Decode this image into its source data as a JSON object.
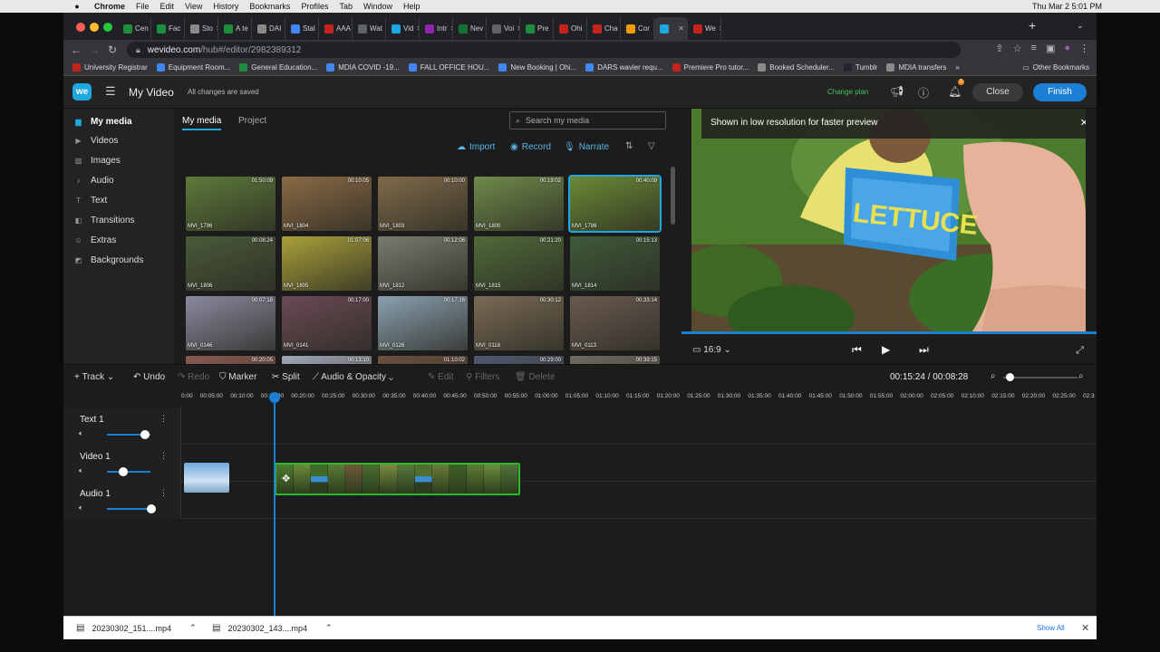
{
  "menubar": {
    "app": "Chrome",
    "items": [
      "File",
      "Edit",
      "View",
      "History",
      "Bookmarks",
      "Profiles",
      "Tab",
      "Window",
      "Help"
    ],
    "clock": "Thu Mar 2  5:01 PM"
  },
  "tabs": [
    {
      "label": "Cen",
      "color": "#1e8e3e"
    },
    {
      "label": "Fac",
      "color": "#1e8e3e"
    },
    {
      "label": "Sto",
      "color": "#8a8a8a"
    },
    {
      "label": "A te",
      "color": "#1e8e3e"
    },
    {
      "label": "DAI",
      "color": "#8a8a8a"
    },
    {
      "label": "Stal",
      "color": "#4285f4"
    },
    {
      "label": "AAA",
      "color": "#c5221f"
    },
    {
      "label": "Wat",
      "color": "#5f6368"
    },
    {
      "label": "Vid",
      "color": "#1ea7e1"
    },
    {
      "label": "Intr",
      "color": "#8e24aa"
    },
    {
      "label": "Nev",
      "color": "#137333"
    },
    {
      "label": "Voi",
      "color": "#5f6368"
    },
    {
      "label": "Pre",
      "color": "#1e8e3e"
    },
    {
      "label": "Ohi",
      "color": "#c5221f"
    },
    {
      "label": "Cha",
      "color": "#c5221f"
    },
    {
      "label": "Cor",
      "color": "#f29900"
    },
    {
      "label": "",
      "color": "#1ea7e1"
    },
    {
      "label": "We",
      "color": "#c5221f"
    }
  ],
  "url": {
    "domain": "wevideo.com",
    "path": "/hub#/editor/2982389312"
  },
  "bookmarks": [
    {
      "label": "University Registrar",
      "color": "#c5221f"
    },
    {
      "label": "Equipment Room...",
      "color": "#4285f4"
    },
    {
      "label": "General Education...",
      "color": "#1e8e3e"
    },
    {
      "label": "MDIA COVID -19...",
      "color": "#4285f4"
    },
    {
      "label": "FALL OFFICE HOU...",
      "color": "#4285f4"
    },
    {
      "label": "New Booking | Ohi...",
      "color": "#4285f4"
    },
    {
      "label": "DARS wavier requ...",
      "color": "#4285f4"
    },
    {
      "label": "Premiere Pro tutor...",
      "color": "#c5221f"
    },
    {
      "label": "Booked Scheduler...",
      "color": "#8a8a8a"
    },
    {
      "label": "Tumblr",
      "color": "#223"
    },
    {
      "label": "MDIA transfers",
      "color": "#8a8a8a"
    }
  ],
  "other_bookmarks": "Other Bookmarks",
  "header": {
    "logo": "we",
    "title": "My Video",
    "save_state": "All changes are saved",
    "change_plan": "Change plan",
    "notification_count": "1",
    "close": "Close",
    "finish": "Finish"
  },
  "sidebar": [
    {
      "label": "My media",
      "icon": "folder-icon",
      "active": true
    },
    {
      "label": "Videos",
      "icon": "video-icon"
    },
    {
      "label": "Images",
      "icon": "image-icon"
    },
    {
      "label": "Audio",
      "icon": "music-icon"
    },
    {
      "label": "Text",
      "icon": "text-icon"
    },
    {
      "label": "Transitions",
      "icon": "transitions-icon"
    },
    {
      "label": "Extras",
      "icon": "extras-icon"
    },
    {
      "label": "Backgrounds",
      "icon": "backgrounds-icon"
    }
  ],
  "media": {
    "tabs": [
      "My media",
      "Project"
    ],
    "search_placeholder": "Search my media",
    "import": "Import",
    "record": "Record",
    "narrate": "Narrate",
    "items": [
      {
        "name": "MVI_1796",
        "duration": "01:50:09",
        "color": "#5d7a3a"
      },
      {
        "name": "MVI_1804",
        "duration": "00:10:05",
        "color": "#8a6a45"
      },
      {
        "name": "MVI_1803",
        "duration": "00:10:00",
        "color": "#7f6a4a"
      },
      {
        "name": "MVI_1800",
        "duration": "00:19:02",
        "color": "#6f8a4a"
      },
      {
        "name": "MVI_1798",
        "duration": "00:40:09",
        "color": "#6a8a35",
        "selected": true
      },
      {
        "name": "MVI_1806",
        "duration": "00:08:24",
        "color": "#4a5a3a"
      },
      {
        "name": "MVI_1805",
        "duration": "01:07:06",
        "color": "#a9a03a"
      },
      {
        "name": "MVI_1812",
        "duration": "00:12:06",
        "color": "#7a7a70"
      },
      {
        "name": "MVI_1815",
        "duration": "00:21:20",
        "color": "#4f6a3a"
      },
      {
        "name": "MVI_1814",
        "duration": "00:15:13",
        "color": "#3f5a3a"
      },
      {
        "name": "MVI_0146",
        "duration": "00:07:18",
        "color": "#8a8aa0"
      },
      {
        "name": "MVI_0141",
        "duration": "00:17:00",
        "color": "#6a4a55"
      },
      {
        "name": "MVI_0126",
        "duration": "00:17:16",
        "color": "#8aa0b0"
      },
      {
        "name": "MVI_0118",
        "duration": "00:30:12",
        "color": "#7a6a55"
      },
      {
        "name": "MVI_0113",
        "duration": "00:33:14",
        "color": "#6a5a50"
      },
      {
        "name": "",
        "duration": "00:20:05",
        "color": "#8a5a50"
      },
      {
        "name": "",
        "duration": "00:13:10",
        "color": "#a0a8b8"
      },
      {
        "name": "",
        "duration": "01:10:02",
        "color": "#6a5040"
      },
      {
        "name": "",
        "duration": "00:29:00",
        "color": "#505a70"
      },
      {
        "name": "",
        "duration": "00:39:15",
        "color": "#706a60"
      }
    ]
  },
  "preview": {
    "notice": "Shown in low resolution for faster preview",
    "aspect": "16:9",
    "sign_text": "LETTUCE"
  },
  "toolbar": {
    "track": "Track",
    "undo": "Undo",
    "redo": "Redo",
    "marker": "Marker",
    "split": "Split",
    "audio_opacity": "Audio & Opacity",
    "edit": "Edit",
    "filters": "Filters",
    "delete": "Delete",
    "time": "00:15:24 / 00:08:28"
  },
  "ruler": [
    "0:00",
    "00:05:00",
    "00:10:00",
    "00:15:00",
    "00:20:00",
    "00:25:00",
    "00:30:00",
    "00:35:00",
    "00:40:00",
    "00:45:00",
    "00:50:00",
    "00:55:00",
    "01:00:00",
    "01:05:00",
    "01:10:00",
    "01:15:00",
    "01:20:00",
    "01:25:00",
    "01:30:00",
    "01:35:00",
    "01:40:00",
    "01:45:00",
    "01:50:00",
    "01:55:00",
    "02:00:00",
    "02:05:00",
    "02:10:00",
    "02:15:00",
    "02:20:00",
    "02:25:00",
    "02:3"
  ],
  "tracks": [
    {
      "name": "Text 1",
      "volume": 0.85
    },
    {
      "name": "Video 1",
      "volume": 0.35
    },
    {
      "name": "Audio 1",
      "volume": 1.0
    }
  ],
  "downloads": {
    "files": [
      "20230302_151....mp4",
      "20230302_143....mp4"
    ],
    "show_all": "Show All"
  }
}
